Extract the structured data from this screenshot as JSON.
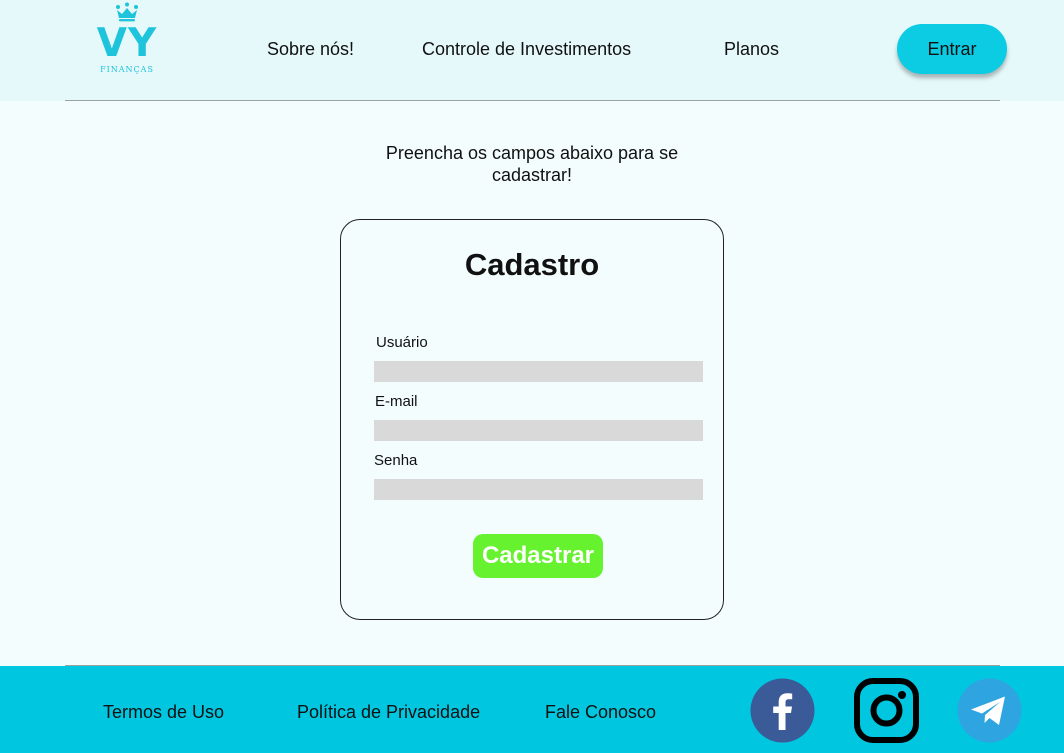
{
  "brand": {
    "name": "VY",
    "tagline": "FINANÇAS",
    "color": "#1ec4dc"
  },
  "nav": {
    "items": [
      {
        "label": "Sobre nós!"
      },
      {
        "label": "Controle de Investimentos"
      },
      {
        "label": "Planos"
      }
    ],
    "login_label": "Entrar"
  },
  "intro_text": "Preencha os campos abaixo para se cadastrar!",
  "form": {
    "title": "Cadastro",
    "fields": [
      {
        "label": "Usuário",
        "value": ""
      },
      {
        "label": "E-mail",
        "value": ""
      },
      {
        "label": "Senha",
        "value": ""
      }
    ],
    "submit_label": "Cadastrar"
  },
  "footer": {
    "links": [
      {
        "label": "Termos de Uso"
      },
      {
        "label": "Política de Privacidade"
      },
      {
        "label": "Fale Conosco"
      }
    ],
    "social": [
      {
        "icon": "facebook-icon",
        "color": "#3b5a98"
      },
      {
        "icon": "instagram-icon",
        "color": "#000000"
      },
      {
        "icon": "telegram-icon",
        "color": "#2ea5e0"
      }
    ]
  },
  "colors": {
    "header_bg": "#e5f9fb",
    "page_bg": "#f4fdfd",
    "accent": "#0ccce4",
    "submit": "#66f22e",
    "footer_bg": "#00c6e0"
  }
}
